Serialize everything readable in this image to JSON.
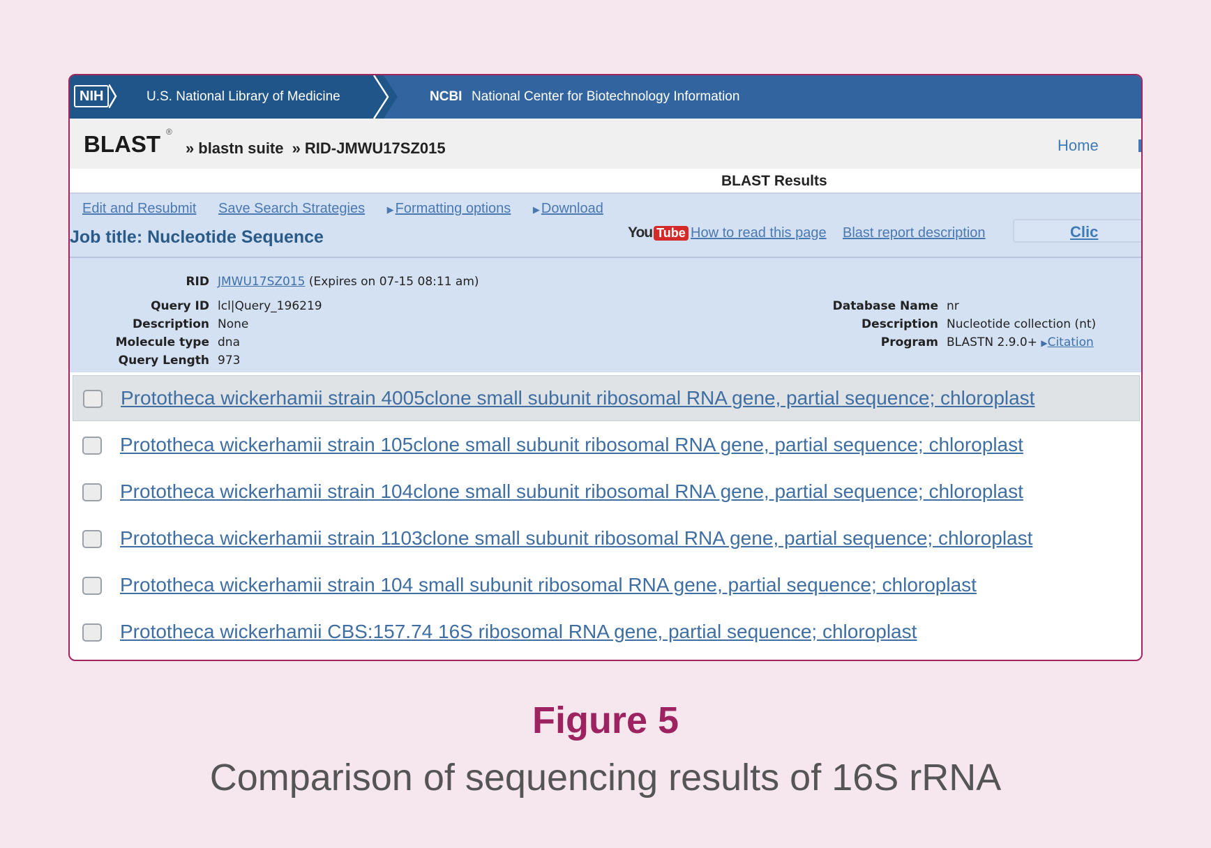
{
  "header": {
    "nih_logo": "NIH",
    "nlm": "U.S. National Library of Medicine",
    "ncbi_abbr": "NCBI",
    "ncbi_full": "National Center for Biotechnology Information"
  },
  "breadcrumb": {
    "blast": "BLAST",
    "reg_mark": "®",
    "suite": "blastn suite",
    "rid_crumb": "RID-JMWU17SZ015",
    "home": "Home"
  },
  "results_heading": "BLAST Results",
  "toolbar": {
    "edit_resubmit": "Edit and Resubmit",
    "save_strategies": "Save Search Strategies",
    "formatting_options": "Formatting options",
    "download": "Download",
    "job_title": "Job title: Nucleotide Sequence",
    "youtube_you": "You",
    "youtube_tube": "Tube",
    "how_to_read": "How to read this page",
    "report_description": "Blast report description",
    "click_text": "Clic"
  },
  "query_info": {
    "rid_label": "RID",
    "rid_value": "JMWU17SZ015",
    "rid_expires": "(Expires on 07-15 08:11 am)",
    "query_id_label": "Query ID",
    "query_id_value": "lcl|Query_196219",
    "description_label": "Description",
    "description_value": "None",
    "molecule_type_label": "Molecule type",
    "molecule_type_value": "dna",
    "query_length_label": "Query Length",
    "query_length_value": "973",
    "database_name_label": "Database Name",
    "database_name_value": "nr",
    "db_description_label": "Description",
    "db_description_value": "Nucleotide collection (nt)",
    "program_label": "Program",
    "program_value": "BLASTN 2.9.0+",
    "citation": "Citation"
  },
  "results": [
    "Prototheca wickerhamii strain 4005clone small subunit ribosomal RNA gene, partial sequence; chloroplast",
    "Prototheca wickerhamii strain 105clone small subunit ribosomal RNA gene, partial sequence; chloroplast",
    "Prototheca wickerhamii strain 104clone small subunit ribosomal RNA gene, partial sequence; chloroplast",
    "Prototheca wickerhamii strain 1103clone small subunit ribosomal RNA gene, partial sequence; chloroplast",
    "Prototheca wickerhamii strain 104 small subunit ribosomal RNA gene, partial sequence; chloroplast",
    "Prototheca wickerhamii CBS:157.74 16S ribosomal RNA gene, partial sequence; chloroplast"
  ],
  "caption": {
    "figure": "Figure 5",
    "text": "Comparison of sequencing results of 16S rRNA"
  },
  "colors": {
    "nih_bar": "#20558a",
    "ncbi_bar": "#32659f",
    "panel": "#d4e1f2",
    "link": "#3f6ea3",
    "figure_title": "#9c2360",
    "frame_border": "#a3255c"
  }
}
